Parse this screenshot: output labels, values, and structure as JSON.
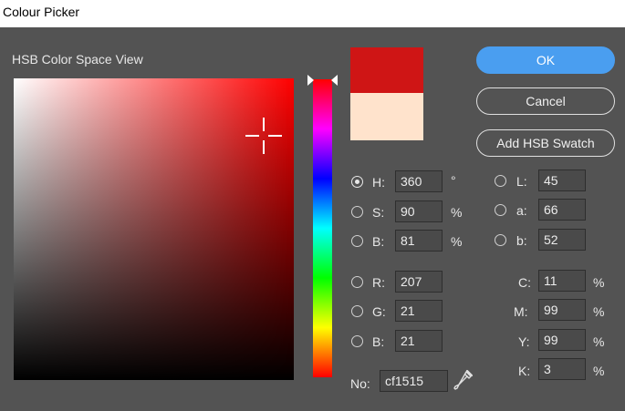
{
  "window": {
    "title": "Colour Picker"
  },
  "section_title": "HSB Color Space View",
  "colors": {
    "hue_base": "#ff0000",
    "new_color": "#cf1515",
    "old_color": "#ffe3cc",
    "accent": "#4a9ef0"
  },
  "buttons": {
    "ok": "OK",
    "cancel": "Cancel",
    "add_swatch": "Add HSB Swatch"
  },
  "hsb": {
    "h": {
      "label": "H:",
      "value": "360",
      "unit": "°",
      "selected": true
    },
    "s": {
      "label": "S:",
      "value": "90",
      "unit": "%"
    },
    "b": {
      "label": "B:",
      "value": "81",
      "unit": "%"
    }
  },
  "lab": {
    "l": {
      "label": "L:",
      "value": "45"
    },
    "a": {
      "label": "a:",
      "value": "66"
    },
    "b": {
      "label": "b:",
      "value": "52"
    }
  },
  "rgb": {
    "r": {
      "label": "R:",
      "value": "207"
    },
    "g": {
      "label": "G:",
      "value": "21"
    },
    "b": {
      "label": "B:",
      "value": "21"
    }
  },
  "cmyk": {
    "c": {
      "label": "C:",
      "value": "11",
      "unit": "%"
    },
    "m": {
      "label": "M:",
      "value": "99",
      "unit": "%"
    },
    "y": {
      "label": "Y:",
      "value": "99",
      "unit": "%"
    },
    "k": {
      "label": "K:",
      "value": "3",
      "unit": "%"
    }
  },
  "hex": {
    "label": "No:",
    "value": "cf1515"
  },
  "icons": {
    "eyedropper": "eyedropper-icon"
  }
}
